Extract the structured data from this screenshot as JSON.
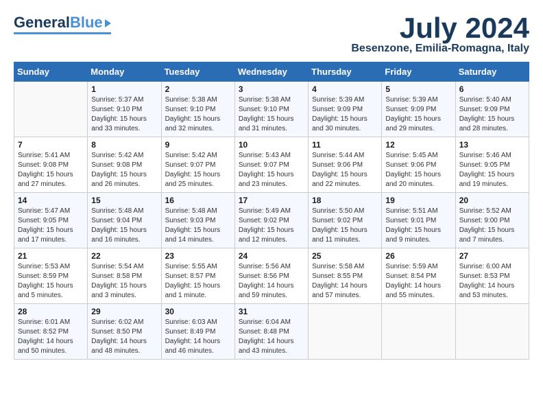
{
  "header": {
    "logo_general": "General",
    "logo_blue": "Blue",
    "month_year": "July 2024",
    "location": "Besenzone, Emilia-Romagna, Italy"
  },
  "weekdays": [
    "Sunday",
    "Monday",
    "Tuesday",
    "Wednesday",
    "Thursday",
    "Friday",
    "Saturday"
  ],
  "weeks": [
    {
      "days": [
        {
          "number": "",
          "info": ""
        },
        {
          "number": "1",
          "info": "Sunrise: 5:37 AM\nSunset: 9:10 PM\nDaylight: 15 hours\nand 33 minutes."
        },
        {
          "number": "2",
          "info": "Sunrise: 5:38 AM\nSunset: 9:10 PM\nDaylight: 15 hours\nand 32 minutes."
        },
        {
          "number": "3",
          "info": "Sunrise: 5:38 AM\nSunset: 9:10 PM\nDaylight: 15 hours\nand 31 minutes."
        },
        {
          "number": "4",
          "info": "Sunrise: 5:39 AM\nSunset: 9:09 PM\nDaylight: 15 hours\nand 30 minutes."
        },
        {
          "number": "5",
          "info": "Sunrise: 5:39 AM\nSunset: 9:09 PM\nDaylight: 15 hours\nand 29 minutes."
        },
        {
          "number": "6",
          "info": "Sunrise: 5:40 AM\nSunset: 9:09 PM\nDaylight: 15 hours\nand 28 minutes."
        }
      ]
    },
    {
      "days": [
        {
          "number": "7",
          "info": "Sunrise: 5:41 AM\nSunset: 9:08 PM\nDaylight: 15 hours\nand 27 minutes."
        },
        {
          "number": "8",
          "info": "Sunrise: 5:42 AM\nSunset: 9:08 PM\nDaylight: 15 hours\nand 26 minutes."
        },
        {
          "number": "9",
          "info": "Sunrise: 5:42 AM\nSunset: 9:07 PM\nDaylight: 15 hours\nand 25 minutes."
        },
        {
          "number": "10",
          "info": "Sunrise: 5:43 AM\nSunset: 9:07 PM\nDaylight: 15 hours\nand 23 minutes."
        },
        {
          "number": "11",
          "info": "Sunrise: 5:44 AM\nSunset: 9:06 PM\nDaylight: 15 hours\nand 22 minutes."
        },
        {
          "number": "12",
          "info": "Sunrise: 5:45 AM\nSunset: 9:06 PM\nDaylight: 15 hours\nand 20 minutes."
        },
        {
          "number": "13",
          "info": "Sunrise: 5:46 AM\nSunset: 9:05 PM\nDaylight: 15 hours\nand 19 minutes."
        }
      ]
    },
    {
      "days": [
        {
          "number": "14",
          "info": "Sunrise: 5:47 AM\nSunset: 9:05 PM\nDaylight: 15 hours\nand 17 minutes."
        },
        {
          "number": "15",
          "info": "Sunrise: 5:48 AM\nSunset: 9:04 PM\nDaylight: 15 hours\nand 16 minutes."
        },
        {
          "number": "16",
          "info": "Sunrise: 5:48 AM\nSunset: 9:03 PM\nDaylight: 15 hours\nand 14 minutes."
        },
        {
          "number": "17",
          "info": "Sunrise: 5:49 AM\nSunset: 9:02 PM\nDaylight: 15 hours\nand 12 minutes."
        },
        {
          "number": "18",
          "info": "Sunrise: 5:50 AM\nSunset: 9:02 PM\nDaylight: 15 hours\nand 11 minutes."
        },
        {
          "number": "19",
          "info": "Sunrise: 5:51 AM\nSunset: 9:01 PM\nDaylight: 15 hours\nand 9 minutes."
        },
        {
          "number": "20",
          "info": "Sunrise: 5:52 AM\nSunset: 9:00 PM\nDaylight: 15 hours\nand 7 minutes."
        }
      ]
    },
    {
      "days": [
        {
          "number": "21",
          "info": "Sunrise: 5:53 AM\nSunset: 8:59 PM\nDaylight: 15 hours\nand 5 minutes."
        },
        {
          "number": "22",
          "info": "Sunrise: 5:54 AM\nSunset: 8:58 PM\nDaylight: 15 hours\nand 3 minutes."
        },
        {
          "number": "23",
          "info": "Sunrise: 5:55 AM\nSunset: 8:57 PM\nDaylight: 15 hours\nand 1 minute."
        },
        {
          "number": "24",
          "info": "Sunrise: 5:56 AM\nSunset: 8:56 PM\nDaylight: 14 hours\nand 59 minutes."
        },
        {
          "number": "25",
          "info": "Sunrise: 5:58 AM\nSunset: 8:55 PM\nDaylight: 14 hours\nand 57 minutes."
        },
        {
          "number": "26",
          "info": "Sunrise: 5:59 AM\nSunset: 8:54 PM\nDaylight: 14 hours\nand 55 minutes."
        },
        {
          "number": "27",
          "info": "Sunrise: 6:00 AM\nSunset: 8:53 PM\nDaylight: 14 hours\nand 53 minutes."
        }
      ]
    },
    {
      "days": [
        {
          "number": "28",
          "info": "Sunrise: 6:01 AM\nSunset: 8:52 PM\nDaylight: 14 hours\nand 50 minutes."
        },
        {
          "number": "29",
          "info": "Sunrise: 6:02 AM\nSunset: 8:50 PM\nDaylight: 14 hours\nand 48 minutes."
        },
        {
          "number": "30",
          "info": "Sunrise: 6:03 AM\nSunset: 8:49 PM\nDaylight: 14 hours\nand 46 minutes."
        },
        {
          "number": "31",
          "info": "Sunrise: 6:04 AM\nSunset: 8:48 PM\nDaylight: 14 hours\nand 43 minutes."
        },
        {
          "number": "",
          "info": ""
        },
        {
          "number": "",
          "info": ""
        },
        {
          "number": "",
          "info": ""
        }
      ]
    }
  ]
}
